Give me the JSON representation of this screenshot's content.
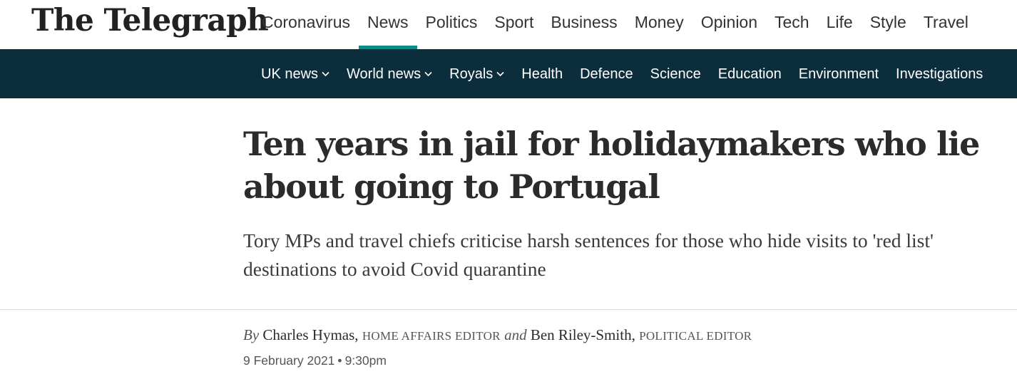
{
  "masthead": {
    "logo_text": "The Telegraph",
    "nav": [
      {
        "label": "Coronavirus",
        "active": false
      },
      {
        "label": "News",
        "active": true
      },
      {
        "label": "Politics",
        "active": false
      },
      {
        "label": "Sport",
        "active": false
      },
      {
        "label": "Business",
        "active": false
      },
      {
        "label": "Money",
        "active": false
      },
      {
        "label": "Opinion",
        "active": false
      },
      {
        "label": "Tech",
        "active": false
      },
      {
        "label": "Life",
        "active": false
      },
      {
        "label": "Style",
        "active": false
      },
      {
        "label": "Travel",
        "active": false
      }
    ],
    "active_color": "#0b8c84"
  },
  "subnav": {
    "background": "#0c2d3c",
    "items": [
      {
        "label": "UK news",
        "dropdown": true
      },
      {
        "label": "World news",
        "dropdown": true
      },
      {
        "label": "Royals",
        "dropdown": true
      },
      {
        "label": "Health",
        "dropdown": false
      },
      {
        "label": "Defence",
        "dropdown": false
      },
      {
        "label": "Science",
        "dropdown": false
      },
      {
        "label": "Education",
        "dropdown": false
      },
      {
        "label": "Environment",
        "dropdown": false
      },
      {
        "label": "Investigations",
        "dropdown": false
      }
    ],
    "dropdown_icon": "chevron-down-icon"
  },
  "article": {
    "headline": "Ten years in jail for holidaymakers who lie about going to Portugal",
    "standfirst": "Tory MPs and travel chiefs criticise harsh sentences for those who hide visits to 'red list' destinations to avoid Covid quarantine",
    "byline": {
      "by_label": "By",
      "author1": "Charles Hymas,",
      "role1": "HOME AFFAIRS EDITOR",
      "and_label": "and",
      "author2": "Ben Riley-Smith,",
      "role2": "POLITICAL EDITOR"
    },
    "date": "9 February 2021",
    "separator": "•",
    "time": "9:30pm"
  }
}
